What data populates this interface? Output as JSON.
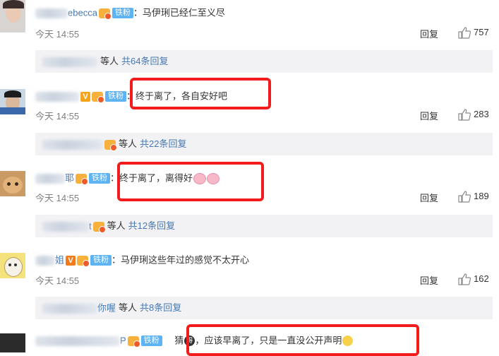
{
  "comments": [
    {
      "username_visible": "ebecca",
      "fan_badge": "铁粉",
      "text": "：马伊琍已经仁至义尽",
      "time": "今天 14:55",
      "reply_label": "回复",
      "likes": "757",
      "summary_suffix": "等人",
      "summary_link": "共64条回复"
    },
    {
      "username_visible": "",
      "fan_badge": "铁粉",
      "text": "：终于离了，各自安好吧",
      "time": "今天 14:55",
      "reply_label": "回复",
      "likes": "283",
      "summary_suffix": "等人",
      "summary_link": "共22条回复"
    },
    {
      "username_visible": "耶",
      "fan_badge": "铁粉",
      "text": "：终于离了，离得好",
      "time": "今天 14:55",
      "reply_label": "回复",
      "likes": "189",
      "summary_name": "t",
      "summary_suffix": "等人",
      "summary_link": "共12条回复"
    },
    {
      "username_visible": "姐",
      "fan_badge": "铁粉",
      "text": "：马伊琍这些年过的感觉不太开心",
      "time": "今天 14:55",
      "reply_label": "回复",
      "likes": "162",
      "summary_name": "你喔",
      "summary_suffix": "等人",
      "summary_link": "共8条回复"
    },
    {
      "username_visible": "P",
      "fan_badge": "铁粉",
      "text_prefix": "猜",
      "emoji_label": "得",
      "text": "，应该早离了，只是一直没公开声明"
    }
  ],
  "badges": {
    "vip": "V"
  },
  "colors": {
    "link": "#4778b1",
    "fan_badge": "#5eb3f3",
    "highlight": "#f21c1c",
    "summary_bg": "#f2f2f5"
  }
}
